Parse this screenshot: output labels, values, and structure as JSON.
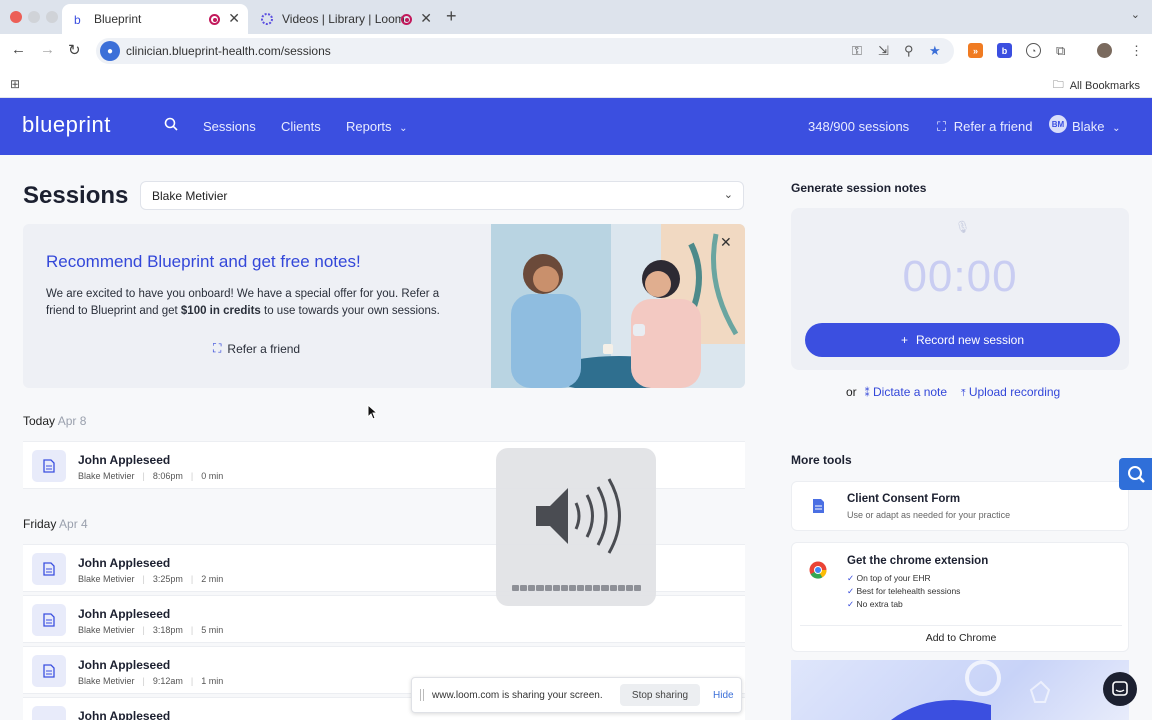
{
  "browser": {
    "tabs": [
      {
        "title": "Blueprint",
        "active": true
      },
      {
        "title": "Videos | Library | Loom",
        "active": false
      }
    ],
    "url": "clinician.blueprint-health.com/sessions",
    "bookmarks_label": "All Bookmarks"
  },
  "app": {
    "logo": "blueprint",
    "nav": {
      "sessions": "Sessions",
      "clients": "Clients",
      "reports": "Reports"
    },
    "session_count": "348/900 sessions",
    "refer_friend": "Refer a friend",
    "user": {
      "initials": "BM",
      "name": "Blake"
    },
    "brand_color": "#3b4fe0"
  },
  "main": {
    "title": "Sessions",
    "clinician_select": "Blake Metivier",
    "promo": {
      "heading": "Recommend Blueprint and get free notes!",
      "body_1": "We are excited to have you onboard! We have a special offer for you. Refer a friend to Blueprint and get ",
      "body_bold": "$100 in credits",
      "body_2": " to use towards your own sessions.",
      "button": "Refer a friend"
    },
    "groups": [
      {
        "day": "Today",
        "date": "Apr 8",
        "sessions": [
          {
            "name": "John Appleseed",
            "clinician": "Blake Metivier",
            "time": "8:06pm",
            "duration": "0 min"
          }
        ]
      },
      {
        "day": "Friday",
        "date": "Apr 4",
        "sessions": [
          {
            "name": "John Appleseed",
            "clinician": "Blake Metivier",
            "time": "3:25pm",
            "duration": "2 min"
          },
          {
            "name": "John Appleseed",
            "clinician": "Blake Metivier",
            "time": "3:18pm",
            "duration": "5 min"
          },
          {
            "name": "John Appleseed",
            "clinician": "Blake Metivier",
            "time": "9:12am",
            "duration": "1 min"
          },
          {
            "name": "John Appleseed",
            "clinician": "",
            "time": "",
            "duration": ""
          }
        ]
      }
    ]
  },
  "side": {
    "generate_title": "Generate session notes",
    "timer": "00:00",
    "record_button": "Record new session",
    "or": "or",
    "dictate": "Dictate a note",
    "upload": "Upload recording",
    "more_tools_title": "More tools",
    "consent": {
      "title": "Client Consent Form",
      "subtitle": "Use or adapt as needed for your practice"
    },
    "chrome_ext": {
      "title": "Get the chrome extension",
      "bullets": [
        "On top of your EHR",
        "Best for telehealth sessions",
        "No extra tab"
      ],
      "button": "Add to Chrome"
    }
  },
  "overlays": {
    "share_message": "www.loom.com is sharing your screen.",
    "stop_sharing": "Stop sharing",
    "hide": "Hide",
    "volume_level": 1.0
  }
}
